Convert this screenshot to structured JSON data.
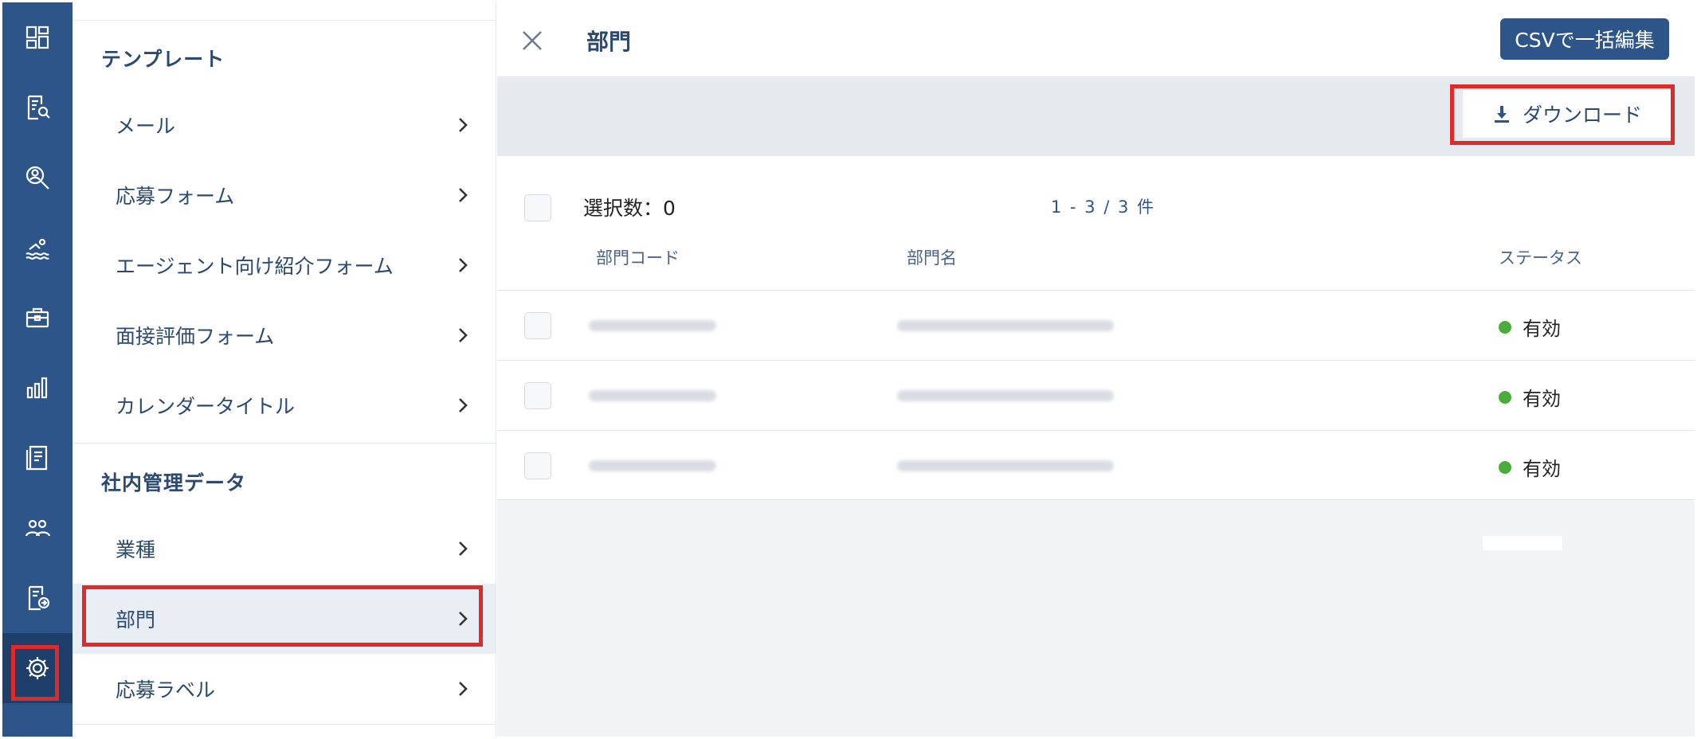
{
  "rail": {
    "items": [
      {
        "icon": "dashboard-icon"
      },
      {
        "icon": "document-search-icon"
      },
      {
        "icon": "person-search-icon"
      },
      {
        "icon": "swimmer-icon"
      },
      {
        "icon": "briefcase-icon"
      },
      {
        "icon": "bar-chart-icon"
      },
      {
        "icon": "report-icon"
      },
      {
        "icon": "users-icon"
      },
      {
        "icon": "document-export-icon"
      },
      {
        "icon": "gear-icon"
      }
    ],
    "accent": "#2e5589",
    "highlight": "#e02a2a"
  },
  "menu": {
    "sections": [
      {
        "title": "テンプレート",
        "items": [
          "メール",
          "応募フォーム",
          "エージェント向け紹介フォーム",
          "面接評価フォーム",
          "カレンダータイトル"
        ]
      },
      {
        "title": "社内管理データ",
        "items": [
          "業種",
          "部門",
          "応募ラベル"
        ]
      }
    ],
    "selected": "部門"
  },
  "main": {
    "title": "部門",
    "csv_button": "CSVで一括編集",
    "download_button": "ダウンロード",
    "selection_count": "選択数：0",
    "pagination": "1 - 3 / 3 件",
    "columns": [
      "部門コード",
      "部門名",
      "ステータス"
    ],
    "rows": [
      {
        "code": "",
        "name": "",
        "status": "有効"
      },
      {
        "code": "",
        "name": "",
        "status": "有効"
      },
      {
        "code": "",
        "name": "",
        "status": "有効"
      }
    ],
    "status_color": "#4aac3a"
  }
}
